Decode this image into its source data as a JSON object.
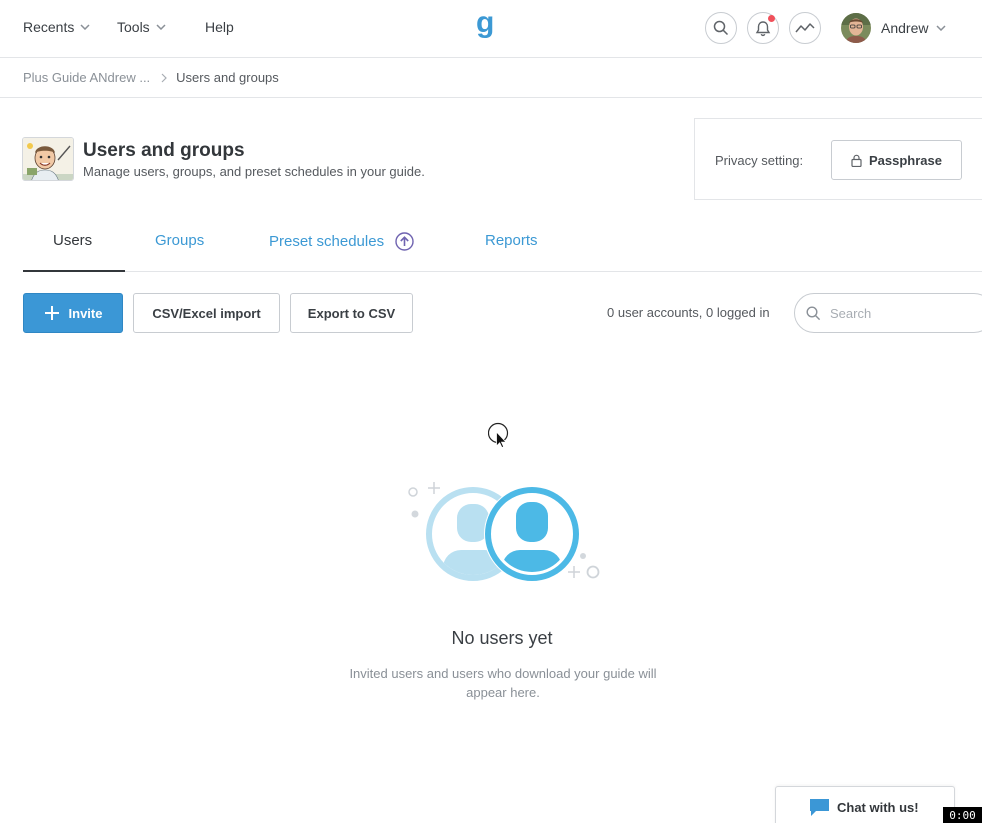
{
  "nav": {
    "recents": "Recents",
    "tools": "Tools",
    "help": "Help",
    "logo_letter": "g",
    "user_name": "Andrew"
  },
  "breadcrumb": {
    "parent": "Plus Guide ANdrew ...",
    "current": "Users and groups"
  },
  "header": {
    "title": "Users and groups",
    "subtitle": "Manage users, groups, and preset schedules in your guide."
  },
  "privacy": {
    "label": "Privacy setting:",
    "value": "Passphrase"
  },
  "tabs": [
    {
      "label": "Users",
      "active": true
    },
    {
      "label": "Groups",
      "active": false
    },
    {
      "label": "Preset schedules",
      "active": false,
      "icon": "upgrade-arrow-icon"
    },
    {
      "label": "Reports",
      "active": false
    }
  ],
  "toolbar": {
    "invite": "Invite",
    "csv_import": "CSV/Excel import",
    "export_csv": "Export to CSV",
    "user_count": "0 user accounts, 0 logged in",
    "search_placeholder": "Search"
  },
  "empty_state": {
    "title": "No users yet",
    "description": "Invited users and users who download your guide will appear here."
  },
  "chat": {
    "label": "Chat with us!"
  },
  "timer": "0:00",
  "colors": {
    "accent": "#3b97d6",
    "link": "#3c99d4",
    "notification": "#f0505a",
    "illustration_light": "#b9e0f1",
    "illustration_dark": "#4cb9e6"
  }
}
